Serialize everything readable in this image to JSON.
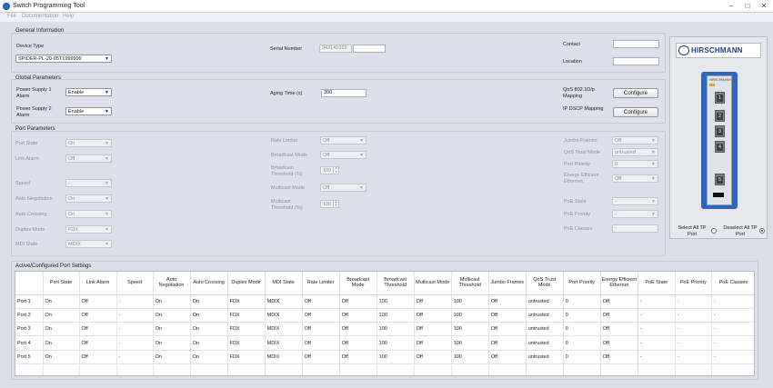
{
  "window": {
    "title": "Switch Programming Tool",
    "controls": [
      "–",
      "□",
      "✕"
    ]
  },
  "menu": [
    "File",
    "Documentation",
    "Help"
  ],
  "general": {
    "title": "General Information",
    "device_type_label": "Device Type",
    "device_type_value": "SPIDER-PL-20-05T1999999",
    "serial_label": "Serial Number",
    "serial_value": "942141016",
    "contact_label": "Contact",
    "location_label": "Location"
  },
  "global": {
    "title": "Global Parameters",
    "ps1_label": "Power Supply 1 Alarm",
    "ps1_value": "Enable",
    "ps2_label": "Power Supply 2 Alarm",
    "ps2_value": "Enable",
    "aging_label": "Aging Time (s)",
    "aging_value": "300",
    "qos_label": "QoS 802.1D/p Mapping",
    "qos_button": "Configure",
    "dscp_label": "IP DSCP Mapping",
    "dscp_button": "Configure"
  },
  "port_params": {
    "title": "Port Parameters",
    "col1": [
      {
        "label": "Port State",
        "value": "On",
        "type": "select"
      },
      {
        "label": "Link Alarm",
        "value": "Off",
        "type": "select"
      },
      {
        "label": "Speed",
        "value": "-",
        "type": "select"
      },
      {
        "label": "Auto Negotiation",
        "value": "On",
        "type": "select"
      },
      {
        "label": "Auto Crossing",
        "value": "On",
        "type": "select"
      },
      {
        "label": "Duplex Mode",
        "value": "FDX",
        "type": "select"
      },
      {
        "label": "MDI State",
        "value": "MDIX",
        "type": "select"
      }
    ],
    "col2": [
      {
        "label": "Rate Limiter",
        "value": "Off",
        "type": "select"
      },
      {
        "label": "Broadcast Mode",
        "value": "Off",
        "type": "select"
      },
      {
        "label": "Broadcast Threshold (%)",
        "value": "100",
        "type": "spin"
      },
      {
        "label": "Multicast Mode",
        "value": "Off",
        "type": "select"
      },
      {
        "label": "Multicast Threshold (%)",
        "value": "100",
        "type": "spin"
      }
    ],
    "col3": [
      {
        "label": "Jumbo Frames",
        "value": "Off",
        "type": "select"
      },
      {
        "label": "QoS Trust Mode",
        "value": "untrusted",
        "type": "select"
      },
      {
        "label": "Port Priority",
        "value": "0",
        "type": "select"
      },
      {
        "label": "Energy Efficient Ethernet",
        "value": "Off",
        "type": "select"
      },
      {
        "label": "PoE State",
        "value": "-",
        "type": "select"
      },
      {
        "label": "PoE Priority",
        "value": "-",
        "type": "select"
      },
      {
        "label": "PoE Classes",
        "value": "-",
        "type": "input"
      }
    ]
  },
  "brand": {
    "logo_text": "HIRSCHMANN",
    "device_label": "HIRSCHMANN",
    "ports": [
      "1",
      "2",
      "3",
      "4",
      "5"
    ],
    "select_all": "Select All TP Port",
    "deselect_all": "Deselect All TP Port"
  },
  "table": {
    "title": "Active/Configured Port Settings",
    "headers": [
      "",
      "Port State",
      "Link Alarm",
      "Speed",
      "Auto Negotiation",
      "Auto Crossing",
      "Duplex Mode",
      "MDI State",
      "Rate Limiter",
      "Broadcast Mode",
      "Broadcast Threshold",
      "Multicast Mode",
      "Multicast Threshold",
      "Jumbo Frames",
      "QoS Trust Mode",
      "Port Priority",
      "Energy Efficient Ethernet",
      "PoE State",
      "PoE Priority",
      "PoE Classes"
    ],
    "rows": [
      [
        "Port 1",
        "On",
        "Off",
        "-",
        "On",
        "On",
        "FDX",
        "MDIX",
        "Off",
        "Off",
        "100",
        "Off",
        "100",
        "Off",
        "untrusted",
        "0",
        "Off",
        "-",
        "-",
        "-"
      ],
      [
        "Port 2",
        "On",
        "Off",
        "-",
        "On",
        "On",
        "FDX",
        "MDIX",
        "Off",
        "Off",
        "100",
        "Off",
        "100",
        "Off",
        "untrusted",
        "0",
        "Off",
        "-",
        "-",
        "-"
      ],
      [
        "Port 3",
        "On",
        "Off",
        "-",
        "On",
        "On",
        "FDX",
        "MDIX",
        "Off",
        "Off",
        "100",
        "Off",
        "100",
        "Off",
        "untrusted",
        "0",
        "Off",
        "-",
        "-",
        "-"
      ],
      [
        "Port 4",
        "On",
        "Off",
        "-",
        "On",
        "On",
        "FDX",
        "MDIX",
        "Off",
        "Off",
        "100",
        "Off",
        "100",
        "Off",
        "untrusted",
        "0",
        "Off",
        "-",
        "-",
        "-"
      ],
      [
        "Port 5",
        "On",
        "Off",
        "-",
        "On",
        "On",
        "FDX",
        "MDIX",
        "Off",
        "Off",
        "100",
        "Off",
        "100",
        "Off",
        "untrusted",
        "0",
        "Off",
        "-",
        "-",
        "-"
      ]
    ]
  }
}
